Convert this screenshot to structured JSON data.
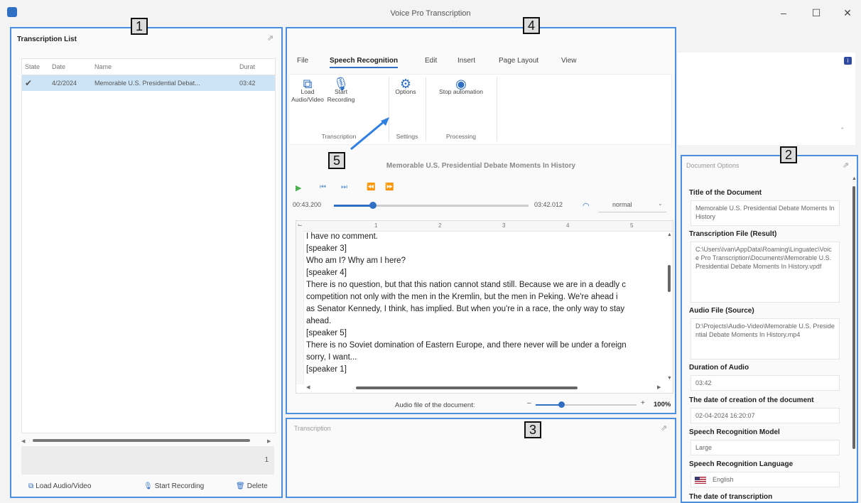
{
  "window": {
    "title": "Voice Pro Transcription",
    "controls": [
      "–",
      "☐",
      "✕"
    ]
  },
  "callouts": [
    "1",
    "2",
    "3",
    "4",
    "5"
  ],
  "transcription_list": {
    "title": "Transcription List",
    "columns": [
      "State",
      "Date",
      "Name",
      "Durat"
    ],
    "rows": [
      {
        "state": "✔",
        "date": "4/2/2024",
        "name": "Memorable U.S. Presidential Debat...",
        "duration": "03:42"
      }
    ],
    "count": "1",
    "buttons": {
      "load": "Load Audio/Video",
      "record": "Start Recording",
      "delete": "Delete"
    }
  },
  "ribbon": {
    "tabs": [
      "File",
      "Speech Recognition",
      "Edit",
      "Insert",
      "Page Layout",
      "View"
    ],
    "buttons": {
      "load": "Load Audio/Video",
      "record": "Start Recording",
      "options": "Options",
      "stop": "Stop automation"
    },
    "groups": {
      "transcription": "Transcription",
      "settings": "Settings",
      "processing": "Processing"
    }
  },
  "player": {
    "title": "Memorable U.S. Presidential Debate Moments In History",
    "position": "00:43.200",
    "duration": "03:42.012",
    "progress": 0.2,
    "speed": "normal"
  },
  "editor": {
    "ruler": [
      "1",
      "2",
      "3",
      "4",
      "5"
    ],
    "lines": [
      "I have no comment.",
      "[speaker 3]",
      "Who am I? Why am I here?",
      "[speaker 4]",
      "There is no question, but that this nation cannot stand still. Because we are in a deadly c",
      "competition not only with the men in the Kremlin, but the men in Peking. We're ahead i",
      "as Senator Kennedy, I think, has implied. But when you're in a race, the only way to stay",
      "ahead.",
      "[speaker 5]",
      "There is no Soviet domination of Eastern Europe, and there never will be under a foreign",
      "sorry, I want...",
      "[speaker 1]"
    ],
    "footer_label": "Audio file of the document:",
    "zoom": "100%",
    "zoom_minus": "–",
    "zoom_plus": "+"
  },
  "transcription_panel": {
    "title": "Transcription"
  },
  "document_options": {
    "title": "Document Options",
    "fields": [
      {
        "label": "Title of the Document",
        "value": "Memorable U.S. Presidential Debate Moments In History"
      },
      {
        "label": "Transcription File (Result)",
        "value": "C:\\Users\\Ivan\\AppData\\Roaming\\Linguatec\\Voice Pro Transcription\\Documents\\Memorable U.S. Presidential Debate Moments In History.vpdf"
      },
      {
        "label": "Audio File (Source)",
        "value": "D:\\Projects\\Audio-Video\\Memorable U.S. Presidential Debate Moments In History.mp4"
      },
      {
        "label": "Duration of Audio",
        "value": "03:42"
      },
      {
        "label": "The date of creation of the document",
        "value": "02-04-2024 16:20:07"
      },
      {
        "label": "Speech Recognition Model",
        "value": "Large"
      },
      {
        "label": "Speech Recognition Language",
        "value": "English"
      },
      {
        "label": "The date of transcription",
        "value": ""
      }
    ]
  },
  "colors": {
    "accent": "#2f6fc4",
    "callout": "#4a8fe0",
    "check": "#2e9e3a",
    "selection": "#cde4f7"
  }
}
